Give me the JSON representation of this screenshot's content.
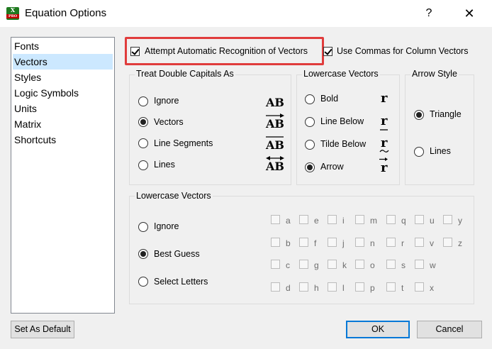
{
  "window": {
    "title": "Equation Options",
    "icon_text": "X",
    "icon_sub": "PRO",
    "help": "?",
    "close": "✕"
  },
  "categories": [
    "Fonts",
    "Vectors",
    "Styles",
    "Logic Symbols",
    "Units",
    "Matrix",
    "Shortcuts"
  ],
  "selected_category": "Vectors",
  "top_options": {
    "auto_recognition": {
      "label": "Attempt Automatic Recognition of Vectors",
      "checked": true
    },
    "commas": {
      "label": "Use Commas for Column Vectors",
      "checked": true
    }
  },
  "double_capitals": {
    "title": "Treat Double Capitals As",
    "options": [
      {
        "label": "Ignore",
        "symbol": "AB",
        "checked": false
      },
      {
        "label": "Vectors",
        "symbol": "AB",
        "checked": true
      },
      {
        "label": "Line Segments",
        "symbol": "AB",
        "checked": false
      },
      {
        "label": "Lines",
        "symbol": "AB",
        "checked": false
      }
    ]
  },
  "lowercase_style": {
    "title": "Lowercase Vectors",
    "options": [
      {
        "label": "Bold",
        "symbol": "r",
        "checked": false
      },
      {
        "label": "Line Below",
        "symbol": "r",
        "checked": false
      },
      {
        "label": "Tilde Below",
        "symbol": "r",
        "checked": false
      },
      {
        "label": "Arrow",
        "symbol": "r",
        "checked": true
      }
    ]
  },
  "arrow_style": {
    "title": "Arrow Style",
    "options": [
      {
        "label": "Triangle",
        "checked": true
      },
      {
        "label": "Lines",
        "checked": false
      }
    ]
  },
  "lowercase_vectors": {
    "title": "Lowercase Vectors",
    "options": [
      {
        "label": "Ignore",
        "checked": false
      },
      {
        "label": "Best Guess",
        "checked": true
      },
      {
        "label": "Select Letters",
        "checked": false
      }
    ],
    "letter_columns": [
      [
        "a",
        "b",
        "c",
        "d"
      ],
      [
        "e",
        "f",
        "g",
        "h"
      ],
      [
        "i",
        "j",
        "k",
        "l"
      ],
      [
        "m",
        "n",
        "o",
        "p"
      ],
      [
        "q",
        "r",
        "s",
        "t"
      ],
      [
        "u",
        "v",
        "w",
        "x"
      ],
      [
        "y",
        "z"
      ]
    ]
  },
  "buttons": {
    "default": "Set As Default",
    "ok": "OK",
    "cancel": "Cancel"
  },
  "colors": {
    "highlight": "#e03c3c",
    "selection": "#cce8ff",
    "accent": "#0078d7"
  }
}
